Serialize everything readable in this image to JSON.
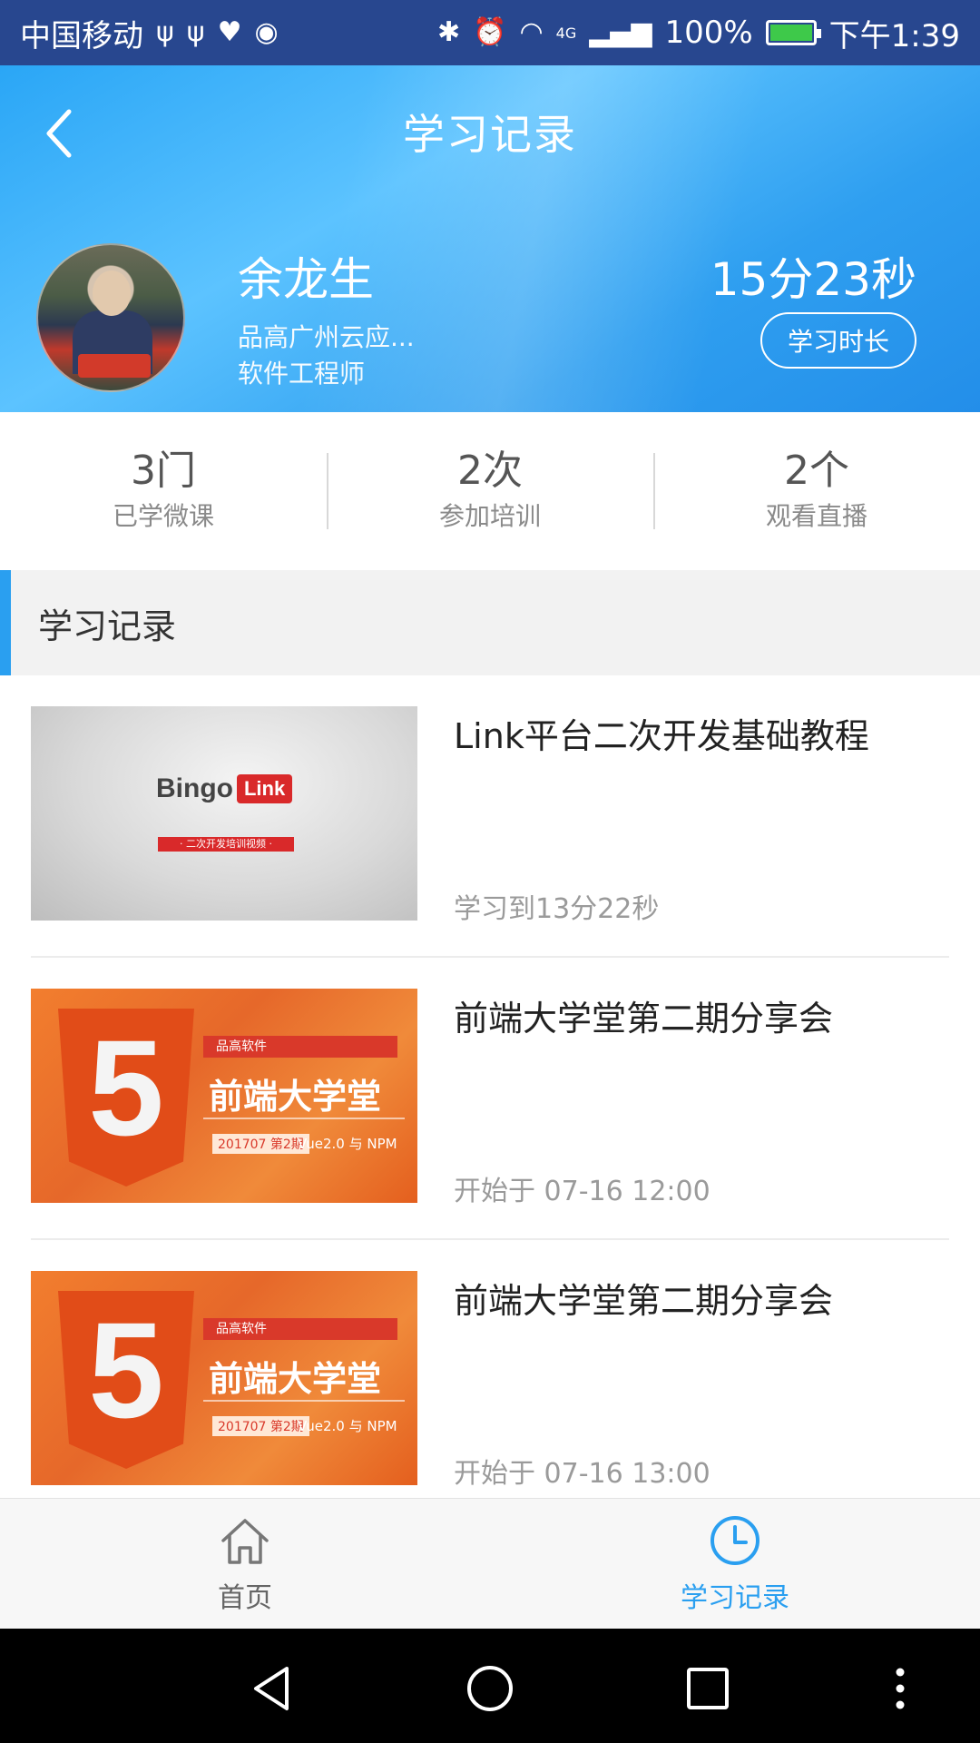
{
  "status_bar": {
    "carrier": "中国移动",
    "network": "4G",
    "battery": "100%",
    "time": "下午1:39"
  },
  "header": {
    "title": "学习记录",
    "user": {
      "name": "余龙生",
      "company": "品高广州云应...",
      "role": "软件工程师"
    },
    "study_time": "15分23秒",
    "study_time_button": "学习时长"
  },
  "stats": [
    {
      "value": "3门",
      "label": "已学微课"
    },
    {
      "value": "2次",
      "label": "参加培训"
    },
    {
      "value": "2个",
      "label": "观看直播"
    }
  ],
  "section": {
    "title": "学习记录"
  },
  "records": [
    {
      "title": "Link平台二次开发基础教程",
      "meta": "学习到13分22秒",
      "thumb": {
        "brand": "Bingo",
        "badge": "Link",
        "subtitle": "· 二次开发培训视频 ·"
      }
    },
    {
      "title": "前端大学堂第二期分享会",
      "meta": "开始于 07-16 12:00",
      "thumb": {
        "digit": "5",
        "tag": "品高软件",
        "title": "前端大学堂",
        "issue": "201707 第2期",
        "topic": "Vue2.0 与 NPM"
      }
    },
    {
      "title": "前端大学堂第二期分享会",
      "meta": "开始于 07-16 13:00",
      "thumb": {
        "digit": "5",
        "tag": "品高软件",
        "title": "前端大学堂",
        "issue": "201707 第2期",
        "topic": "Vue2.0 与 NPM"
      }
    }
  ],
  "bottom_nav": [
    {
      "label": "首页",
      "icon": "home-icon",
      "active": false
    },
    {
      "label": "学习记录",
      "icon": "clock-icon",
      "active": true
    }
  ],
  "colors": {
    "accent": "#2a9ff0",
    "status_bar": "#28478f",
    "battery_fill": "#3ec94a"
  }
}
